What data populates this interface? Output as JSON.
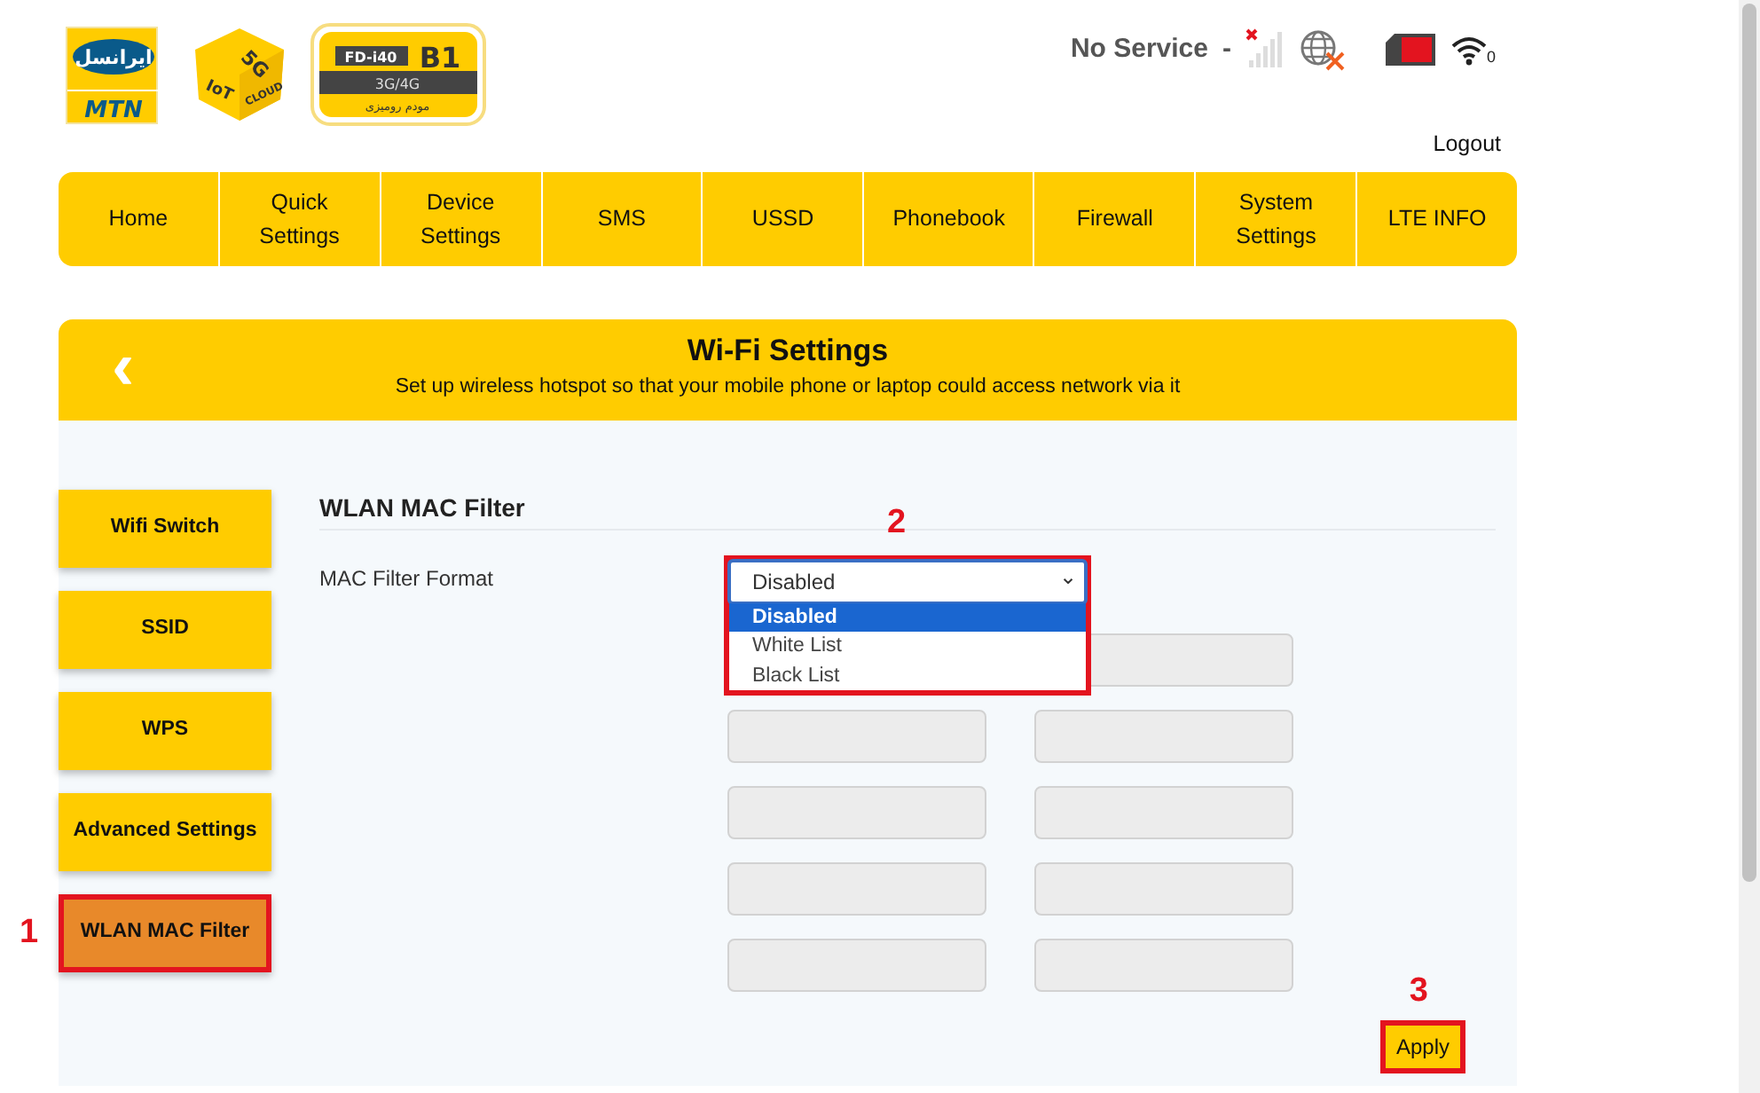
{
  "logos": {
    "operator": {
      "name": "ایرانسل",
      "brand": "MTN"
    },
    "cube": {
      "top": "5G",
      "left": "IoT",
      "right": "CLOUD"
    },
    "device": {
      "model": "FD-i40",
      "band": "B1",
      "network": "3G/4G",
      "caption": "مودم رومیزی"
    }
  },
  "status": {
    "service": "No Service",
    "separator": "-",
    "signal_connected": false,
    "internet_connected": false,
    "wifi_clients": "0"
  },
  "logout": "Logout",
  "nav": [
    {
      "label": "Home"
    },
    {
      "label": "Quick Settings"
    },
    {
      "label": "Device Settings"
    },
    {
      "label": "SMS"
    },
    {
      "label": "USSD"
    },
    {
      "label": "Phonebook"
    },
    {
      "label": "Firewall"
    },
    {
      "label": "System Settings"
    },
    {
      "label": "LTE INFO"
    }
  ],
  "header": {
    "back": "‹",
    "title": "Wi-Fi Settings",
    "subtitle": "Set up wireless hotspot so that your mobile phone or laptop could access network via it"
  },
  "sidebar": [
    {
      "label": "Wifi Switch",
      "selected": false
    },
    {
      "label": "SSID",
      "selected": false
    },
    {
      "label": "WPS",
      "selected": false
    },
    {
      "label": "Advanced Settings",
      "selected": false
    },
    {
      "label": "WLAN MAC Filter",
      "selected": true,
      "annotation": "1"
    }
  ],
  "form": {
    "heading": "WLAN MAC Filter",
    "label": "MAC Filter Format",
    "select": {
      "value": "Disabled",
      "caret": "⌄",
      "expanded": true,
      "annotation": "2",
      "options": [
        {
          "label": "Disabled",
          "selected": true
        },
        {
          "label": "White List",
          "selected": false
        },
        {
          "label": "Black List",
          "selected": false
        }
      ]
    },
    "mac_rows": [
      {
        "right": {
          "disabled": true
        }
      },
      {
        "left": {
          "disabled": true
        },
        "right": {
          "disabled": true
        }
      },
      {
        "left": {
          "disabled": true
        },
        "right": {
          "disabled": true
        }
      },
      {
        "left": {
          "disabled": true
        },
        "right": {
          "disabled": true
        }
      },
      {
        "left": {
          "disabled": true
        },
        "right": {
          "disabled": true
        }
      }
    ],
    "apply": {
      "label": "Apply",
      "annotation": "3"
    }
  }
}
